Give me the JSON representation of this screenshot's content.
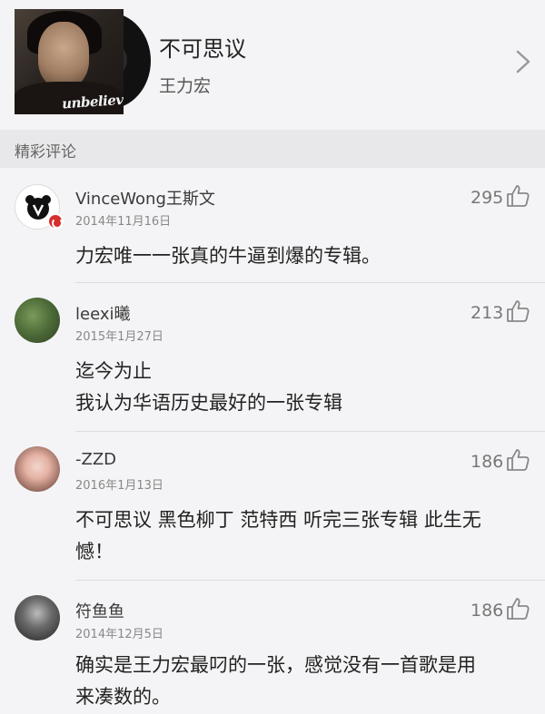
{
  "song": {
    "title": "不可思议",
    "artist": "王力宏",
    "cover_text": "unbelievable"
  },
  "section": {
    "title": "精彩评论"
  },
  "comments": [
    {
      "user": "VinceWong王斯文",
      "date": "2014年11月16日",
      "likes": "295",
      "lines": [
        "力宏唯一一张真的牛逼到爆的专辑。"
      ],
      "avatar": "bear-avatar",
      "verified": true
    },
    {
      "user": "leexi曦",
      "date": "2015年1月27日",
      "likes": "213",
      "lines": [
        "迄今为止",
        "我认为华语历史最好的一张专辑"
      ],
      "avatar": "photo-avatar"
    },
    {
      "user": "-ZZD",
      "date": "2016年1月13日",
      "likes": "186",
      "lines": [
        "不可思议 黑色柳丁 范特西 听完三张专辑 此生无",
        "憾！"
      ],
      "avatar": "photo-avatar"
    },
    {
      "user": "符鱼鱼",
      "date": "2014年12月5日",
      "likes": "186",
      "lines": [
        "确实是王力宏最叼的一张，感觉没有一首歌是用",
        "来凑数的。"
      ],
      "avatar": "photo-avatar"
    }
  ],
  "colors": {
    "background": "#f4f4f6",
    "section_bg": "#e8e8ea",
    "badge_red": "#d62d2d"
  },
  "icons": {
    "chevron": "chevron-right-icon",
    "like": "thumbs-up-icon"
  }
}
